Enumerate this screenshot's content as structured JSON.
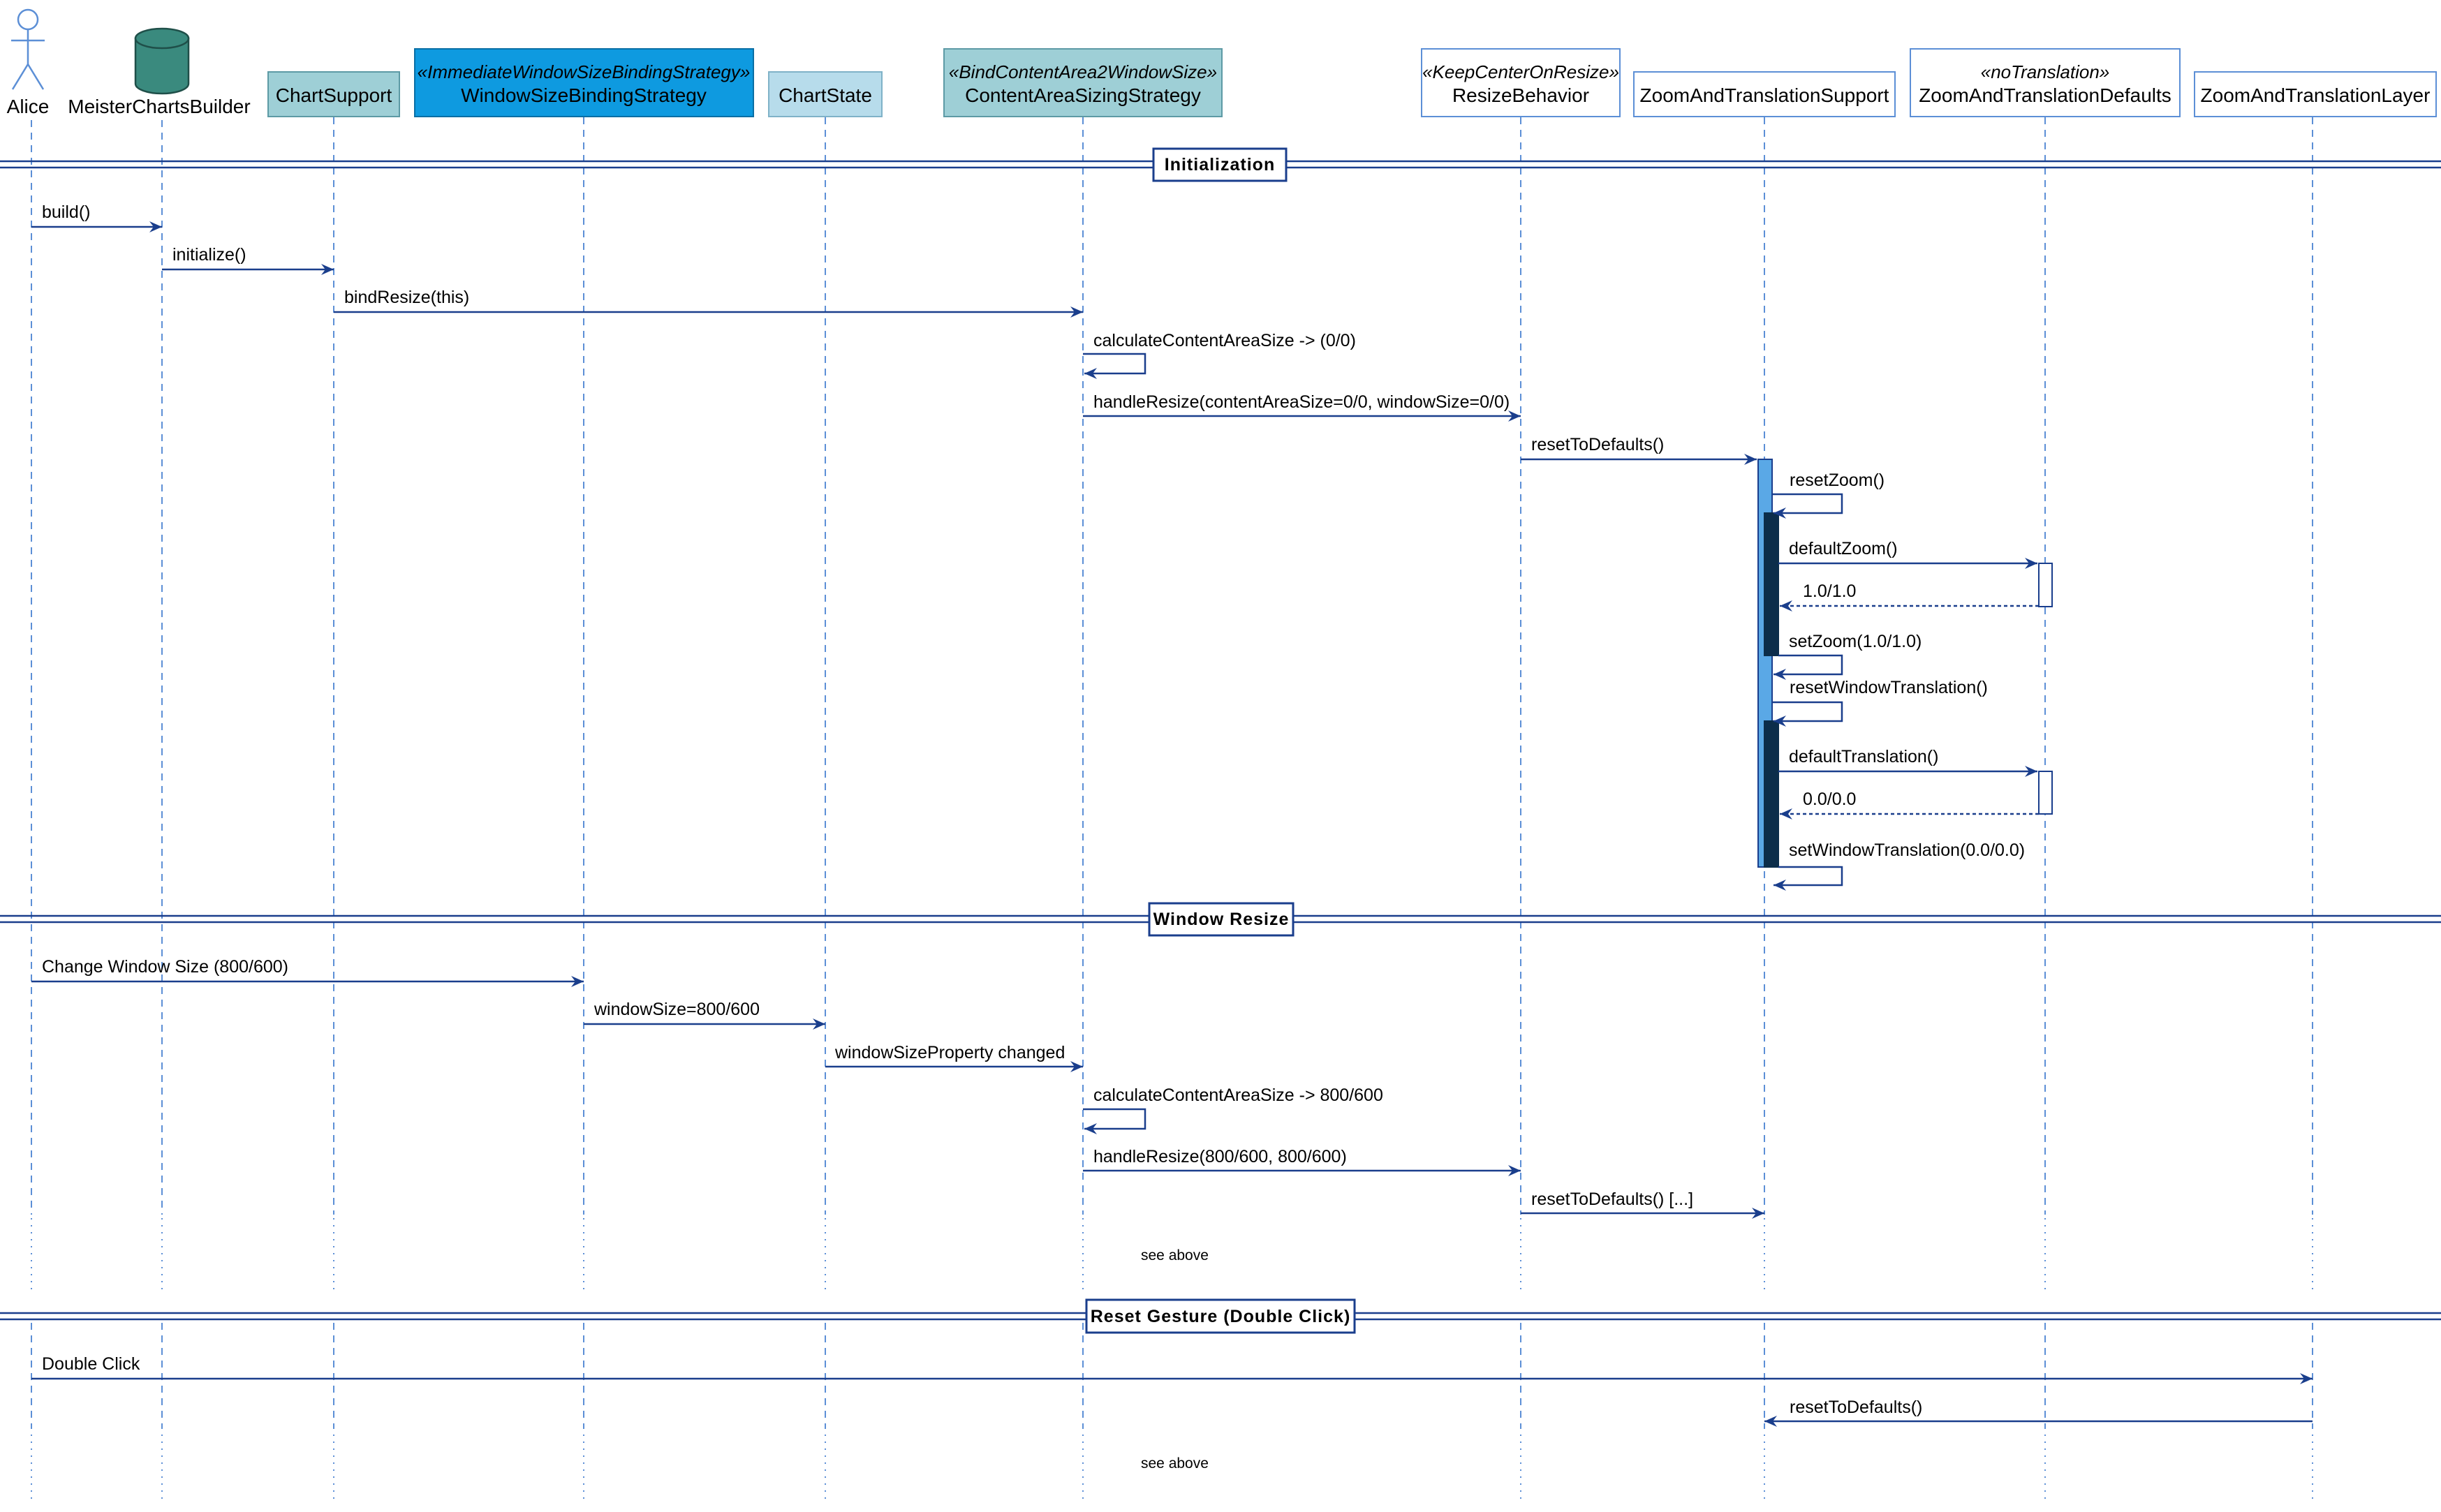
{
  "participants": [
    {
      "id": "alice",
      "name": "Alice",
      "stereotype": ""
    },
    {
      "id": "builder",
      "name": "MeisterChartsBuilder",
      "stereotype": ""
    },
    {
      "id": "chartsupport",
      "name": "ChartSupport",
      "stereotype": ""
    },
    {
      "id": "wsbs",
      "name": "WindowSizeBindingStrategy",
      "stereotype": "«ImmediateWindowSizeBindingStrategy»"
    },
    {
      "id": "chartstate",
      "name": "ChartState",
      "stereotype": ""
    },
    {
      "id": "cass",
      "name": "ContentAreaSizingStrategy",
      "stereotype": "«BindContentArea2WindowSize»"
    },
    {
      "id": "resize",
      "name": "ResizeBehavior",
      "stereotype": "«KeepCenterOnResize»"
    },
    {
      "id": "zts",
      "name": "ZoomAndTranslationSupport",
      "stereotype": ""
    },
    {
      "id": "ztd",
      "name": "ZoomAndTranslationDefaults",
      "stereotype": "«noTranslation»"
    },
    {
      "id": "ztl",
      "name": "ZoomAndTranslationLayer",
      "stereotype": ""
    }
  ],
  "colors": {
    "chartsupport_fill": "#9ecfd6",
    "wsbs_fill": "#0e9ae0",
    "chartstate_fill": "#b7dceb",
    "cass_fill": "#9ecfd6",
    "database_fill": "#3a8a7e",
    "arrow": "#1a3e8c",
    "lifeline": "#5c8fd6",
    "activation_outer": "#5aa8e6",
    "activation_inner": "#0c2d4a"
  },
  "sections": {
    "initialization": "Initialization",
    "window_resize": "Window Resize",
    "reset_gesture": "Reset Gesture (Double Click)"
  },
  "messages": {
    "build": "build()",
    "initialize": "initialize()",
    "bind_resize": "bindResize(this)",
    "calc_content_1": "calculateContentAreaSize -> (0/0)",
    "handle_resize_1": "handleResize(contentAreaSize=0/0, windowSize=0/0)",
    "reset_defaults_1": "resetToDefaults()",
    "reset_zoom": "resetZoom()",
    "default_zoom": "defaultZoom()",
    "zoom_return": "1.0/1.0",
    "set_zoom": "setZoom(1.0/1.0)",
    "reset_window_translation": "resetWindowTranslation()",
    "default_translation": "defaultTranslation()",
    "translation_return": "0.0/0.0",
    "set_window_translation": "setWindowTranslation(0.0/0.0)",
    "change_window_size": "Change Window Size (800/600)",
    "window_size": "windowSize=800/600",
    "property_changed": "windowSizeProperty changed",
    "calc_content_2": "calculateContentAreaSize -> 800/600",
    "handle_resize_2": "handleResize(800/600, 800/600)",
    "reset_defaults_2": "resetToDefaults() [...]",
    "double_click": "Double Click",
    "reset_defaults_3": "resetToDefaults()"
  },
  "notes": {
    "see_above_1": "see above",
    "see_above_2": "see above"
  }
}
